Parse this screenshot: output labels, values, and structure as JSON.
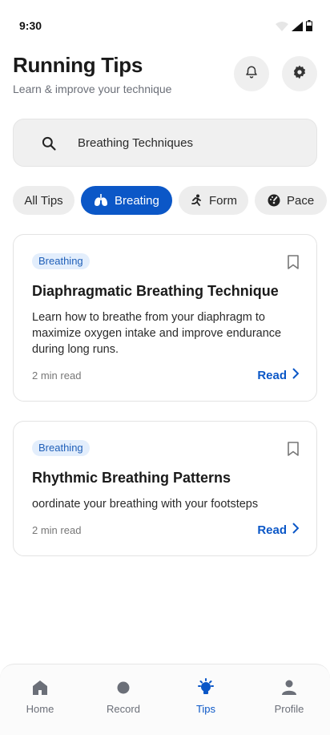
{
  "status": {
    "time": "9:30",
    "icons": [
      "wifi-icon",
      "signal-icon",
      "battery-icon"
    ]
  },
  "header": {
    "title": "Running Tips",
    "subtitle": "Learn & improve your technique",
    "icons": [
      "bell-icon",
      "gear-icon"
    ]
  },
  "search": {
    "value": "Breathing Techniques",
    "icon": "search-icon"
  },
  "chips": [
    {
      "label": "All Tips",
      "active": false,
      "icon": ""
    },
    {
      "label": "Breating",
      "active": true,
      "icon": "lungs-icon"
    },
    {
      "label": "Form",
      "active": false,
      "icon": "runner-icon"
    },
    {
      "label": "Pace",
      "active": false,
      "icon": "gauge-icon"
    }
  ],
  "cards": [
    {
      "tag": "Breathing",
      "title": "Diaphragmatic Breathing Technique",
      "description": "Learn how to breathe from your diaphragm to maximize oxygen intake and improve endurance during long runs.",
      "meta": "2 min read",
      "action": "Read"
    },
    {
      "tag": "Breathing",
      "title": "Rhythmic Breathing Patterns",
      "description": "oordinate your breathing with your footsteps",
      "meta": "2 min read",
      "action": "Read"
    }
  ],
  "nav": [
    {
      "label": "Home",
      "icon": "home-icon",
      "active": false
    },
    {
      "label": "Record",
      "icon": "record-icon",
      "active": false
    },
    {
      "label": "Tips",
      "icon": "lightbulb-icon",
      "active": true
    },
    {
      "label": "Profile",
      "icon": "profile-icon",
      "active": false
    }
  ],
  "colors": {
    "accent": "#0b57c7",
    "tag_bg": "#e3eefc",
    "chip_bg": "#ededed"
  }
}
